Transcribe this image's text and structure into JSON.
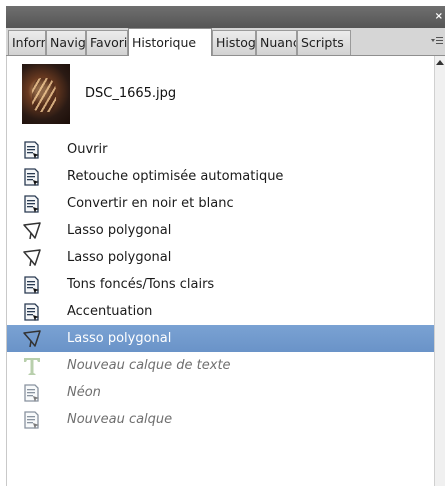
{
  "window": {
    "close_label": "×",
    "menu_icon": "panel-menu-icon"
  },
  "tabs": [
    {
      "label": "Inform",
      "active": false
    },
    {
      "label": "Navig",
      "active": false
    },
    {
      "label": "Favori",
      "active": false
    },
    {
      "label": "Historique",
      "active": true
    },
    {
      "label": "Histog",
      "active": false
    },
    {
      "label": "Nuanc",
      "active": false
    },
    {
      "label": "Scripts",
      "active": false
    }
  ],
  "snapshot": {
    "filename": "DSC_1665.jpg"
  },
  "history": [
    {
      "label": "Ouvrir",
      "icon": "document-icon",
      "state": "done"
    },
    {
      "label": "Retouche optimisée automatique",
      "icon": "document-icon",
      "state": "done"
    },
    {
      "label": "Convertir en noir et blanc",
      "icon": "document-icon",
      "state": "done"
    },
    {
      "label": "Lasso polygonal",
      "icon": "polygonal-lasso-icon",
      "state": "done"
    },
    {
      "label": "Lasso polygonal",
      "icon": "polygonal-lasso-icon",
      "state": "done"
    },
    {
      "label": "Tons foncés/Tons clairs",
      "icon": "document-icon",
      "state": "done"
    },
    {
      "label": "Accentuation",
      "icon": "document-icon",
      "state": "done"
    },
    {
      "label": "Lasso polygonal",
      "icon": "polygonal-lasso-icon",
      "state": "selected"
    },
    {
      "label": "Nouveau calque de texte",
      "icon": "text-tool-icon",
      "state": "future"
    },
    {
      "label": "Néon",
      "icon": "document-icon",
      "state": "future"
    },
    {
      "label": "Nouveau calque",
      "icon": "document-icon",
      "state": "future"
    }
  ],
  "colors": {
    "selected_row": "#6a93c8",
    "text_icon_green": "#9fc08a"
  }
}
